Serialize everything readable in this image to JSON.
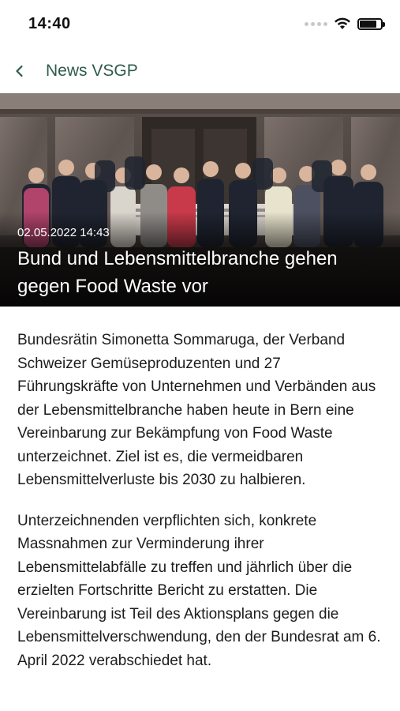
{
  "status_bar": {
    "time": "14:40",
    "signal_icon": "signal-dots-icon",
    "wifi_icon": "wifi-icon",
    "battery_icon": "battery-icon",
    "battery_level": 0.8
  },
  "nav": {
    "back_icon": "chevron-left-icon",
    "title": "News VSGP",
    "accent_color": "#2f5b4a"
  },
  "article": {
    "date": "02.05.2022 14:43",
    "title": "Bund und Lebensmittelbranche gehen gegen Food Waste vor",
    "paragraphs": [
      "Bundesrätin Simonetta Sommaruga, der Verband Schweizer Gemüseproduzenten und 27 Führungskräfte von Unternehmen und Verbänden aus der Lebensmittelbranche haben heute in Bern eine Vereinbarung zur Bekämpfung von Food Waste unterzeichnet. Ziel ist es, die vermeidbaren Lebensmittelverluste bis 2030 zu halbieren.",
      "Unterzeichnenden verpflichten sich, konkrete Massnahmen zur Verminderung ihrer Lebensmittelabfälle zu treffen und jährlich über die erzielten Fortschritte Bericht zu erstatten. Die Vereinbarung ist Teil des Aktionsplans gegen die Lebensmittelverschwendung, den der Bundesrat am 6. April 2022 verabschiedet hat."
    ]
  }
}
